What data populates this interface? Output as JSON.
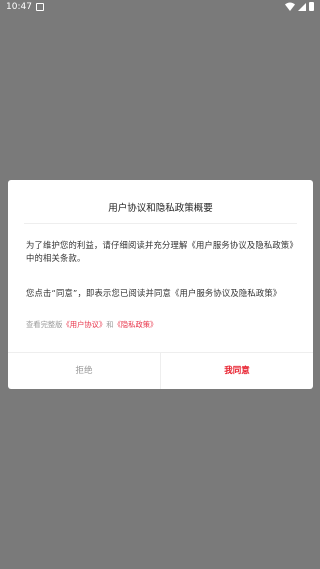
{
  "status_bar": {
    "time": "10:47",
    "icons": [
      "notification-icon",
      "wifi-icon",
      "signal-icon",
      "battery-icon"
    ]
  },
  "dialog": {
    "title": "用户协议和隐私政策概要",
    "paragraph1": "为了维护您的利益，请仔细阅读并充分理解《用户服务协议及隐私政策》中的相关条款。",
    "paragraph2": "您点击“同意”，即表示您已阅读并同意《用户服务协议及隐私政策》",
    "links": {
      "prefix": "查看完整版",
      "user_agreement": "《用户协议》",
      "conjunction": "和",
      "privacy_policy": "《隐私政策》"
    },
    "buttons": {
      "reject": "拒绝",
      "agree": "我同意"
    }
  },
  "colors": {
    "backdrop": "#7a7a7a",
    "dialog_bg": "#ffffff",
    "accent_red": "#e8202e",
    "link_red": "#e8344a",
    "muted_gray": "#999999"
  }
}
